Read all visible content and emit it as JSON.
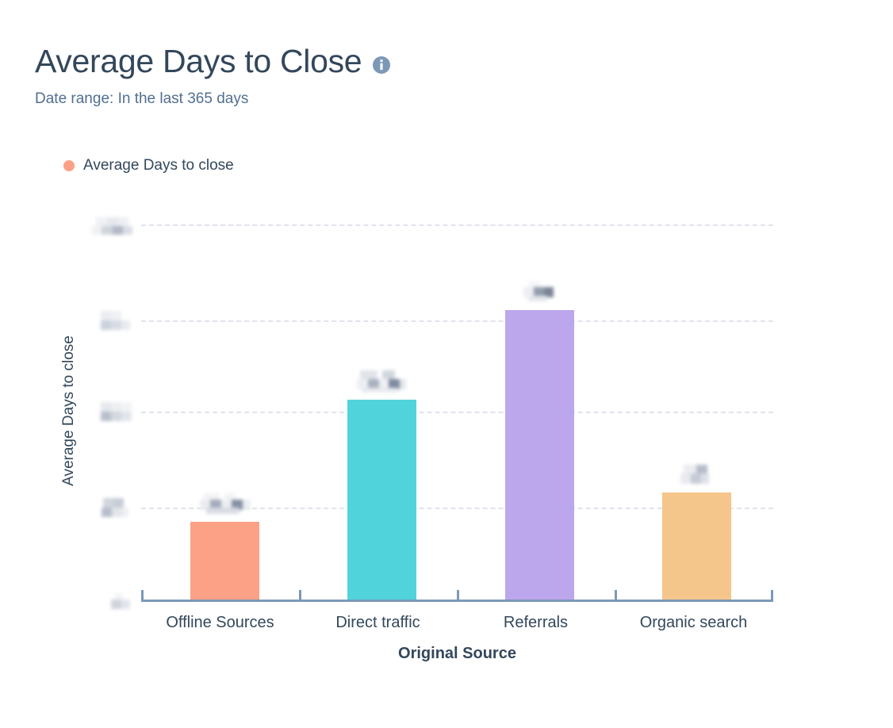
{
  "header": {
    "title": "Average Days to Close",
    "info_icon": "info-icon",
    "date_range": "Date range: In the last 365 days"
  },
  "legend": {
    "items": [
      {
        "label": "Average Days to close",
        "color": "#fca186"
      }
    ]
  },
  "colors": {
    "text_dark": "#33475b",
    "text_muted": "#516f90",
    "axis": "#7c98b6",
    "gridline": "#dfe3eb",
    "info_badge": "#7c98b6",
    "background": "#ffffff"
  },
  "chart_data": {
    "type": "bar",
    "title": "Average Days to Close",
    "subtitle": "Date range: In the last 365 days",
    "xlabel": "Original Source",
    "ylabel": "Average Days to close",
    "grid": true,
    "legend_position": "top-left",
    "categories": [
      "Offline Sources",
      "Direct traffic",
      "Referrals",
      "Organic search"
    ],
    "series": [
      {
        "name": "Average Days to close",
        "values": [
          20.3,
          52.6,
          76.0,
          28.0
        ],
        "value_labels_redacted": true,
        "colors": [
          "#fca186",
          "#51d3db",
          "#bca6ec",
          "#f5c68c"
        ]
      }
    ],
    "ytick_labels_redacted": true,
    "ytick_count": 5,
    "ylim": [
      0,
      100
    ],
    "note": "Y axis tick labels and per-bar value labels are pixelated/redacted in the source screenshot."
  },
  "axes": {
    "y_title": "Average Days to close",
    "x_title": "Original Source",
    "x_categories": [
      {
        "label": "Offline Sources"
      },
      {
        "label": "Direct traffic"
      },
      {
        "label": "Referrals"
      },
      {
        "label": "Organic search"
      }
    ]
  }
}
